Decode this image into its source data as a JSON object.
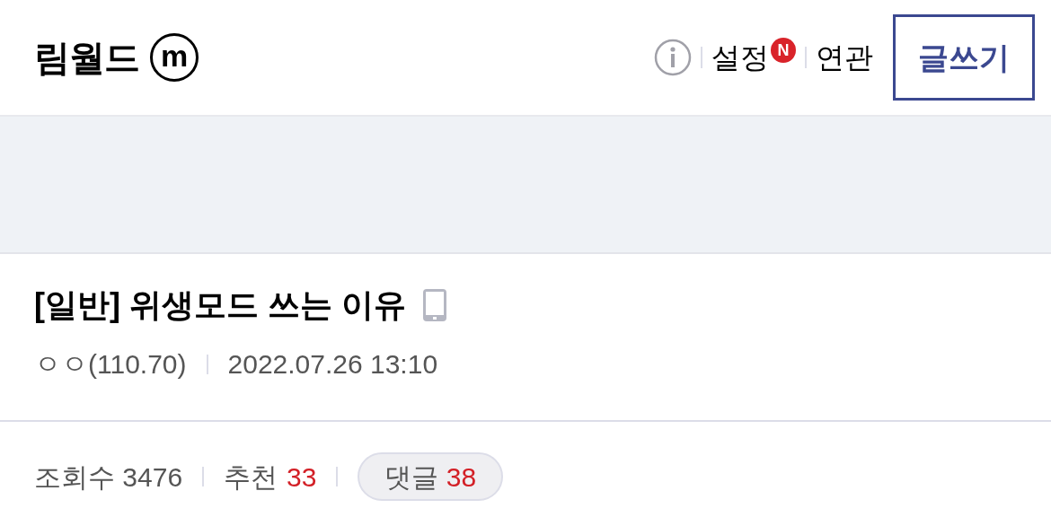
{
  "header": {
    "title": "림월드",
    "logo_mark": "m",
    "links": [
      {
        "kind": "info"
      },
      {
        "kind": "text",
        "label": "설정",
        "badge": "N"
      },
      {
        "kind": "text",
        "label": "연관"
      }
    ],
    "write_button": "글쓰기"
  },
  "post": {
    "title": "[일반] 위생모드 쓰는 이유",
    "author": "ㅇㅇ(110.70)",
    "date": "2022.07.26 13:10"
  },
  "stats": {
    "views_label": "조회수",
    "views": "3476",
    "recommend_label": "추천",
    "recommend": "33",
    "comments_label": "댓글",
    "comments": "38"
  }
}
